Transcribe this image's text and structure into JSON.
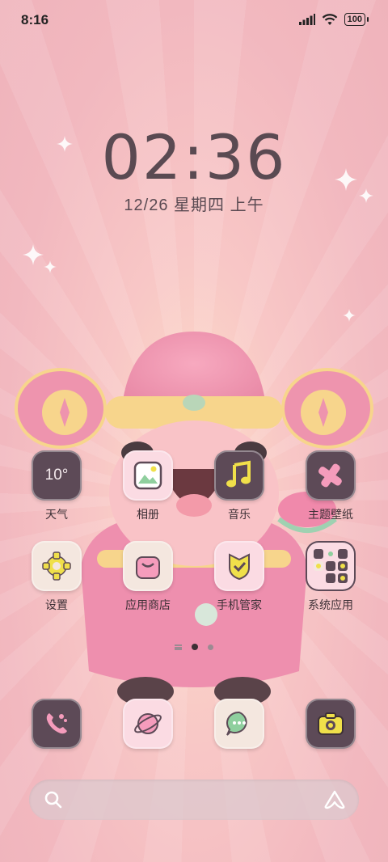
{
  "status_bar": {
    "time": "8:16",
    "battery": "100"
  },
  "lockclock": {
    "hour": "02",
    "minute": "36",
    "separator": ":",
    "date": "12/26 星期四 上午"
  },
  "apps": [
    {
      "label": "天气",
      "icon": "weather-icon",
      "value": "10°"
    },
    {
      "label": "相册",
      "icon": "gallery-icon"
    },
    {
      "label": "音乐",
      "icon": "music-icon"
    },
    {
      "label": "主题壁纸",
      "icon": "theme-icon"
    },
    {
      "label": "设置",
      "icon": "settings-gear-icon"
    },
    {
      "label": "应用商店",
      "icon": "app-store-bag-icon"
    },
    {
      "label": "手机管家",
      "icon": "shield-icon"
    },
    {
      "label": "系统应用",
      "icon": "folder-icon"
    }
  ],
  "dock": [
    {
      "icon": "phone-icon"
    },
    {
      "icon": "browser-planet-icon"
    },
    {
      "icon": "messages-icon"
    },
    {
      "icon": "camera-icon"
    }
  ],
  "pager": {
    "pages": 2,
    "current": 1
  },
  "colors": {
    "accent_dark": "#5d4a57",
    "yellow": "#f0e04a",
    "pink": "#f6c8d2"
  }
}
